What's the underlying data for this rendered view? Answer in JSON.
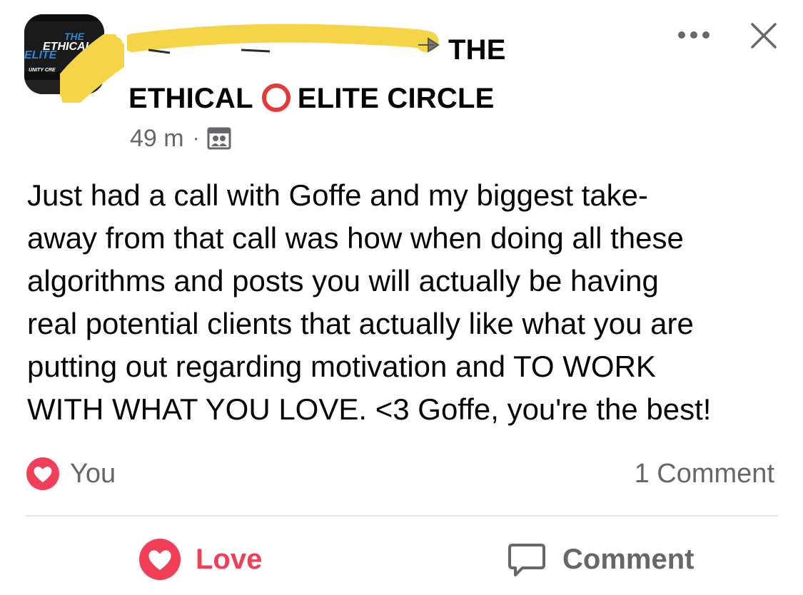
{
  "post": {
    "group_title_part1": "THE",
    "group_title_part2_a": "ETHICAL",
    "group_title_part2_b": "ELITE CIRCLE",
    "timestamp": "49 m",
    "separator": "·",
    "body": "Just had a call with Goffe and my biggest take-\naway from that call was how when doing all these\nalgorithms and posts you will actually be having\nreal potential clients that actually like what you are\nputting out regarding motivation and TO WORK\nWITH WHAT YOU LOVE. <3 Goffe, you're the best!"
  },
  "avatar": {
    "logo_line1": "THE",
    "logo_line2": "ETHICAL",
    "logo_line3": "ELITE",
    "logo_line4": "UNITY CRE"
  },
  "reactions": {
    "reacted_by": "You",
    "comment_count": "1 Comment"
  },
  "actions": {
    "love_label": "Love",
    "comment_label": "Comment"
  },
  "icons": {
    "more": "more-horizontal-icon",
    "close": "close-icon",
    "group": "group-icon",
    "circle": "red-circle-icon",
    "heart": "heart-icon",
    "comment": "comment-bubble-icon"
  },
  "colors": {
    "love_red": "#f33e58",
    "secondary_text": "#65676b",
    "redaction_yellow": "#f5d547",
    "divider": "#e4e6eb"
  }
}
